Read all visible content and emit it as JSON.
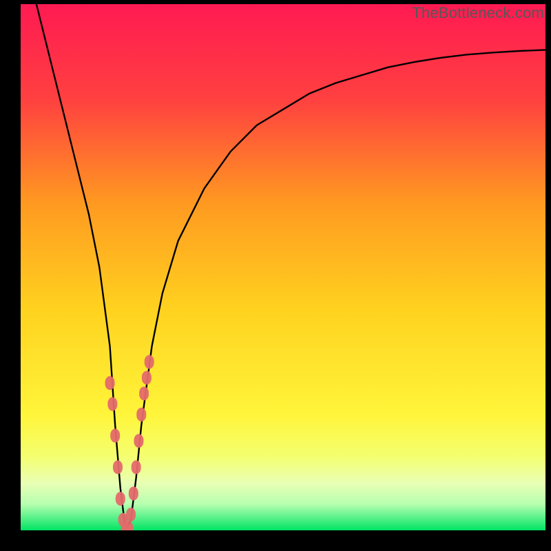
{
  "watermark": "TheBottleneck.com",
  "colors": {
    "gradient_top": "#ff1a52",
    "gradient_mid_upper": "#ff7a2d",
    "gradient_mid": "#ffd21f",
    "gradient_lower": "#f7ff3a",
    "gradient_pale": "#eaffb0",
    "gradient_bottom": "#00e464",
    "curve": "#000000",
    "dots": "#e46a6a",
    "frame": "#000000"
  },
  "chart_data": {
    "type": "line",
    "title": "",
    "xlabel": "",
    "ylabel": "",
    "xlim": [
      0,
      100
    ],
    "ylim": [
      0,
      100
    ],
    "series": [
      {
        "name": "bottleneck-curve",
        "x": [
          3,
          5,
          7,
          9,
          11,
          13,
          15,
          17,
          18,
          19,
          20,
          21,
          22,
          23,
          25,
          27,
          30,
          35,
          40,
          45,
          50,
          55,
          60,
          65,
          70,
          75,
          80,
          85,
          90,
          95,
          100
        ],
        "values": [
          100,
          92,
          84,
          76,
          68,
          60,
          50,
          35,
          20,
          8,
          0,
          2,
          10,
          20,
          35,
          45,
          55,
          65,
          72,
          77,
          80,
          83,
          85,
          86.5,
          88,
          89,
          89.8,
          90.4,
          90.8,
          91.1,
          91.3
        ]
      }
    ],
    "marker_points": {
      "name": "highlighted-points",
      "x": [
        17,
        17.5,
        18,
        18.5,
        19,
        19.5,
        20,
        20.5,
        21,
        21.5,
        22,
        22.5,
        23,
        23.5,
        24,
        24.5
      ],
      "values": [
        28,
        24,
        18,
        12,
        6,
        2,
        0,
        0.5,
        3,
        7,
        12,
        17,
        22,
        26,
        29,
        32
      ]
    }
  }
}
